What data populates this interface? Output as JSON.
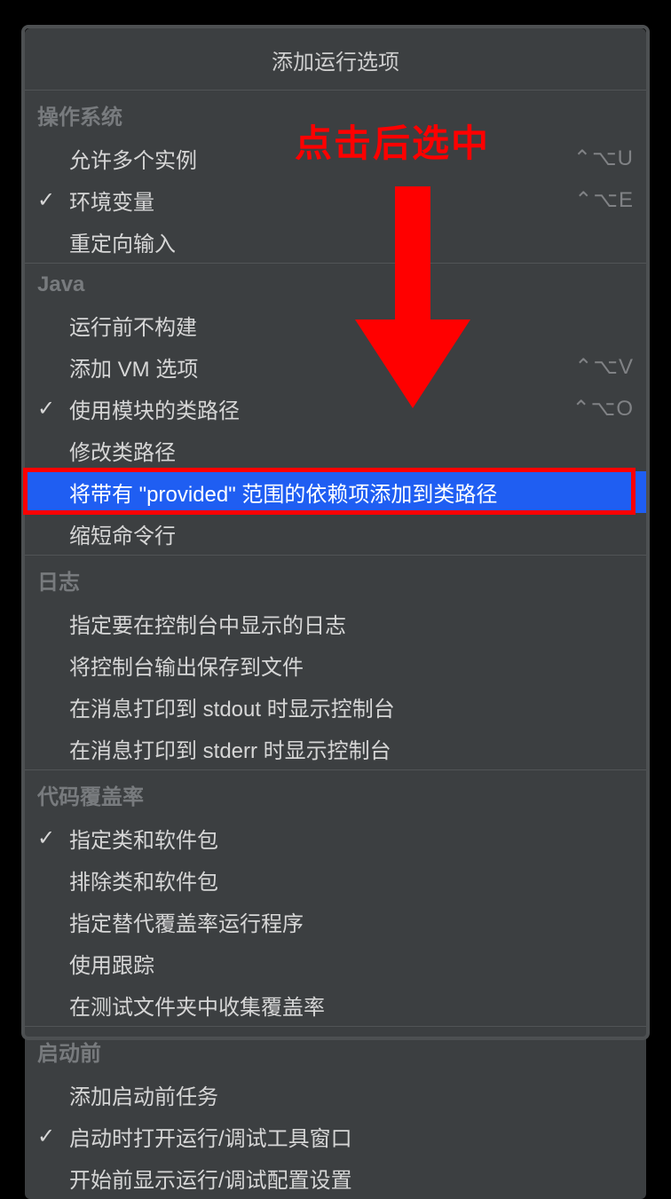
{
  "title": "添加运行选项",
  "annotation": {
    "text": "点击后选中"
  },
  "sections": [
    {
      "name": "os",
      "header": "操作系统",
      "items": [
        {
          "label": "允许多个实例",
          "checked": false,
          "shortcut": "⌃⌥U"
        },
        {
          "label": "环境变量",
          "checked": true,
          "shortcut": "⌃⌥E"
        },
        {
          "label": "重定向输入",
          "checked": false,
          "shortcut": ""
        }
      ]
    },
    {
      "name": "java",
      "header": "Java",
      "items": [
        {
          "label": "运行前不构建",
          "checked": false,
          "shortcut": ""
        },
        {
          "label": "添加 VM 选项",
          "checked": false,
          "shortcut": "⌃⌥V"
        },
        {
          "label": "使用模块的类路径",
          "checked": true,
          "shortcut": "⌃⌥O"
        },
        {
          "label": "修改类路径",
          "checked": false,
          "shortcut": ""
        },
        {
          "label": "将带有 \"provided\" 范围的依赖项添加到类路径",
          "checked": false,
          "shortcut": "",
          "selected": true
        },
        {
          "label": "缩短命令行",
          "checked": false,
          "shortcut": ""
        }
      ]
    },
    {
      "name": "logs",
      "header": "日志",
      "items": [
        {
          "label": "指定要在控制台中显示的日志",
          "checked": false,
          "shortcut": ""
        },
        {
          "label": "将控制台输出保存到文件",
          "checked": false,
          "shortcut": ""
        },
        {
          "label": "在消息打印到 stdout 时显示控制台",
          "checked": false,
          "shortcut": ""
        },
        {
          "label": "在消息打印到 stderr 时显示控制台",
          "checked": false,
          "shortcut": ""
        }
      ]
    },
    {
      "name": "coverage",
      "header": "代码覆盖率",
      "items": [
        {
          "label": "指定类和软件包",
          "checked": true,
          "shortcut": ""
        },
        {
          "label": "排除类和软件包",
          "checked": false,
          "shortcut": ""
        },
        {
          "label": "指定替代覆盖率运行程序",
          "checked": false,
          "shortcut": ""
        },
        {
          "label": "使用跟踪",
          "checked": false,
          "shortcut": ""
        },
        {
          "label": "在测试文件夹中收集覆盖率",
          "checked": false,
          "shortcut": ""
        }
      ]
    },
    {
      "name": "before-launch",
      "header": "启动前",
      "items": [
        {
          "label": "添加启动前任务",
          "checked": false,
          "shortcut": ""
        },
        {
          "label": "启动时打开运行/调试工具窗口",
          "checked": true,
          "shortcut": ""
        },
        {
          "label": "开始前显示运行/调试配置设置",
          "checked": false,
          "shortcut": ""
        }
      ]
    }
  ]
}
